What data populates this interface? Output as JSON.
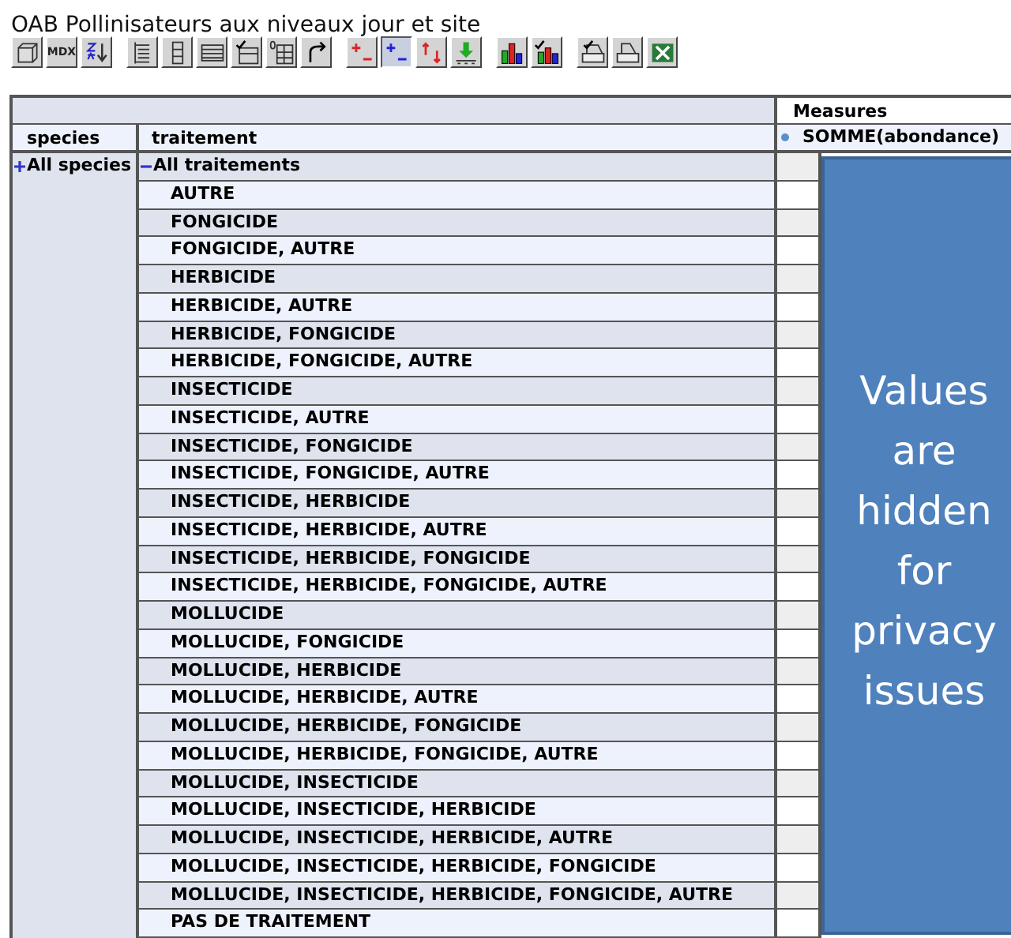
{
  "title": "OAB Pollinisateurs aux niveaux jour et site",
  "toolbar": [
    [
      {
        "kind": "cube",
        "pressed": false
      },
      {
        "kind": "text",
        "label": "MDX",
        "pressed": false
      },
      {
        "kind": "sort",
        "pressed": false
      }
    ],
    [
      {
        "kind": "tree",
        "pressed": false
      },
      {
        "kind": "columns",
        "pressed": false
      },
      {
        "kind": "table",
        "pressed": false
      },
      {
        "kind": "check-table",
        "pressed": false
      },
      {
        "kind": "zero-table",
        "pressed": false
      },
      {
        "kind": "swap",
        "pressed": false
      }
    ],
    [
      {
        "kind": "red-plus-minus",
        "pressed": false
      },
      {
        "kind": "blue-plus-minus",
        "pressed": true
      },
      {
        "kind": "arrows",
        "pressed": false
      },
      {
        "kind": "drill",
        "pressed": false
      }
    ],
    [
      {
        "kind": "chart",
        "pressed": false
      },
      {
        "kind": "check-chart",
        "pressed": false
      }
    ],
    [
      {
        "kind": "print-setup",
        "pressed": false
      },
      {
        "kind": "print",
        "pressed": false
      },
      {
        "kind": "excel",
        "pressed": false
      }
    ]
  ],
  "table": {
    "measures_header": "Measures",
    "columns": [
      "species",
      "traitement"
    ],
    "measure": "SOMME(abondance)",
    "species": {
      "label": "All species",
      "expanded": false
    },
    "traitement": {
      "label": "All traitements",
      "expanded": true,
      "children": [
        {
          "label": "AUTRE"
        },
        {
          "label": "FONGICIDE"
        },
        {
          "label": "FONGICIDE, AUTRE"
        },
        {
          "label": "HERBICIDE"
        },
        {
          "label": "HERBICIDE, AUTRE"
        },
        {
          "label": "HERBICIDE, FONGICIDE"
        },
        {
          "label": "HERBICIDE, FONGICIDE, AUTRE"
        },
        {
          "label": "INSECTICIDE"
        },
        {
          "label": "INSECTICIDE, AUTRE"
        },
        {
          "label": "INSECTICIDE, FONGICIDE"
        },
        {
          "label": "INSECTICIDE, FONGICIDE, AUTRE"
        },
        {
          "label": "INSECTICIDE, HERBICIDE"
        },
        {
          "label": "INSECTICIDE, HERBICIDE, AUTRE"
        },
        {
          "label": "INSECTICIDE, HERBICIDE, FONGICIDE"
        },
        {
          "label": "INSECTICIDE, HERBICIDE, FONGICIDE, AUTRE"
        },
        {
          "label": "MOLLUCIDE"
        },
        {
          "label": "MOLLUCIDE, FONGICIDE"
        },
        {
          "label": "MOLLUCIDE, HERBICIDE"
        },
        {
          "label": "MOLLUCIDE, HERBICIDE, AUTRE"
        },
        {
          "label": "MOLLUCIDE, HERBICIDE, FONGICIDE"
        },
        {
          "label": "MOLLUCIDE, HERBICIDE, FONGICIDE, AUTRE"
        },
        {
          "label": "MOLLUCIDE, INSECTICIDE"
        },
        {
          "label": "MOLLUCIDE, INSECTICIDE, HERBICIDE"
        },
        {
          "label": "MOLLUCIDE, INSECTICIDE, HERBICIDE, AUTRE"
        },
        {
          "label": "MOLLUCIDE, INSECTICIDE, HERBICIDE, FONGICIDE"
        },
        {
          "label": "MOLLUCIDE, INSECTICIDE, HERBICIDE, FONGICIDE, AUTRE"
        },
        {
          "label": "PAS DE TRAITEMENT"
        }
      ]
    }
  },
  "overlay": {
    "text": "Values are hidden for privacy issues"
  }
}
